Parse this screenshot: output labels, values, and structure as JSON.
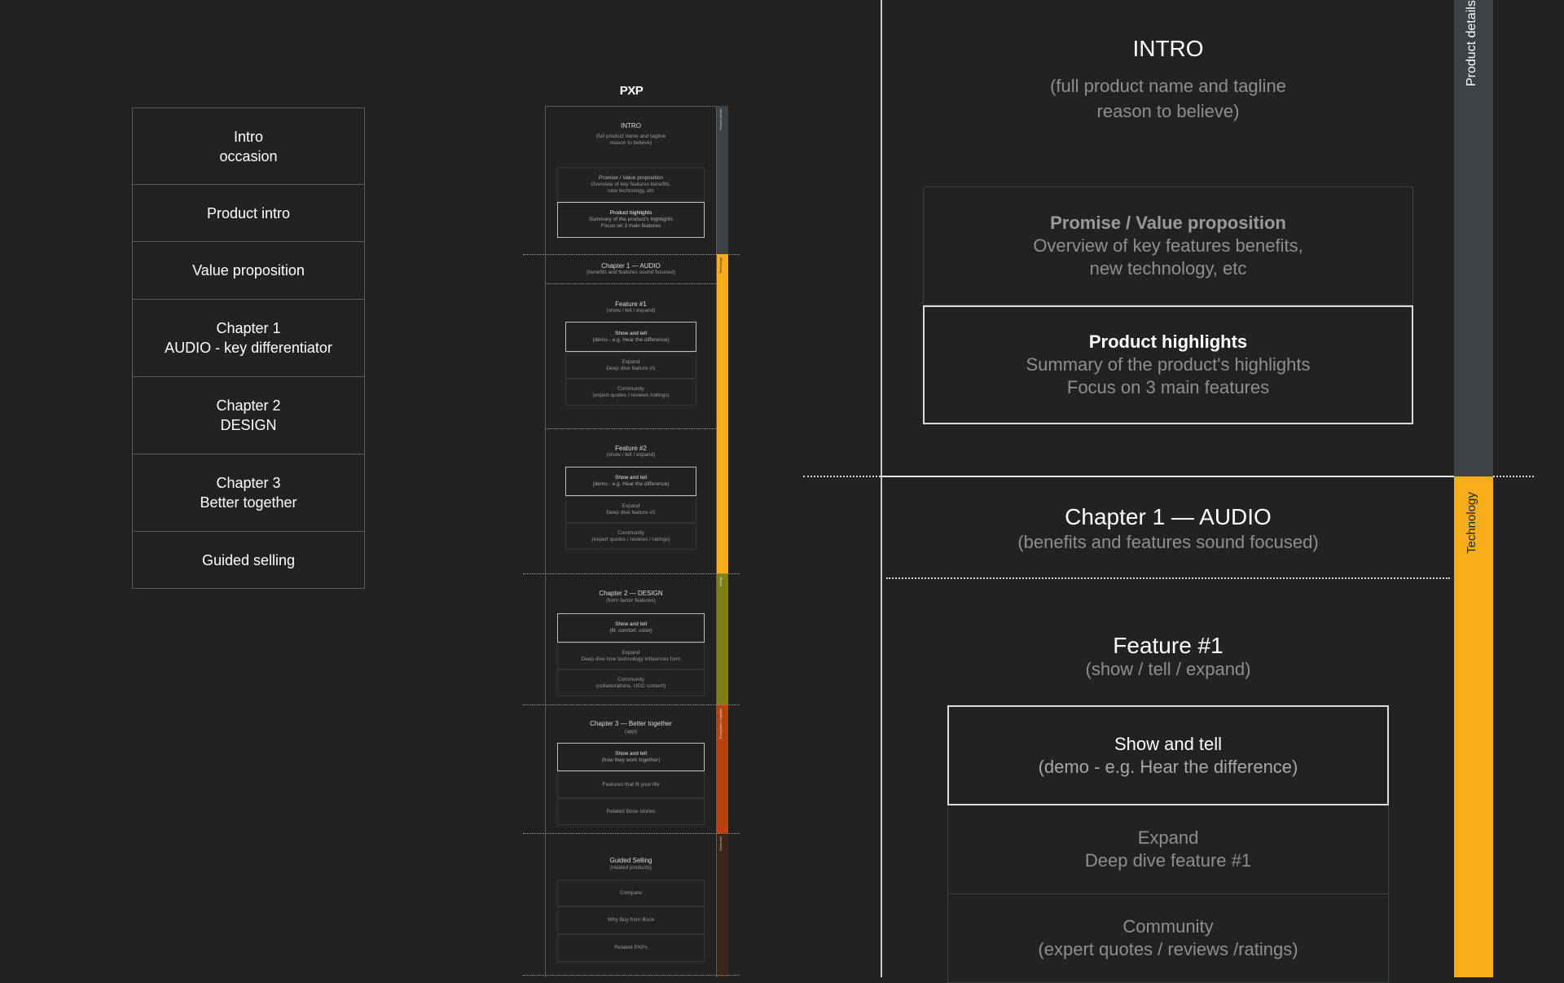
{
  "outline": [
    {
      "line1": "Intro",
      "line2": "occasion"
    },
    {
      "line1": "Product intro",
      "line2": ""
    },
    {
      "line1": "Value proposition",
      "line2": ""
    },
    {
      "line1": "Chapter 1",
      "line2": "AUDIO - key differentiator"
    },
    {
      "line1": "Chapter 2",
      "line2": "DESIGN"
    },
    {
      "line1": "Chapter 3",
      "line2": "Better together"
    },
    {
      "line1": "Guided selling",
      "line2": ""
    }
  ],
  "mini": {
    "logo": "PXP",
    "intro": {
      "title": "INTRO",
      "sub1": "(full product name and tagline",
      "sub2": "reason to believe)",
      "promise": [
        "Promise / Value proposition",
        "Overview of key features benefits,",
        "new technology, etc"
      ],
      "highlights": [
        "Product highlights",
        "Summary of the product's highlights",
        "Focus on 3 main features"
      ],
      "side": "Product details"
    },
    "ch1": {
      "title": "Chapter 1 — AUDIO",
      "sub": "(benefits and features sound focused)",
      "side": "Technology"
    },
    "f1": {
      "title": "Feature #1",
      "sub": "(show / tell / expand)",
      "show": [
        "Show and tell",
        "(demo - e.g. Hear the difference)"
      ],
      "expand": [
        "Expand",
        "Deep dive feature #1"
      ],
      "community": [
        "Community",
        "(expert quotes / reviews /ratings)"
      ]
    },
    "f2": {
      "title": "Feature #2",
      "sub": "(show / tell / expand)",
      "show": [
        "Show and tell",
        "(demo - e.g. Hear the difference)"
      ],
      "expand": [
        "Expand",
        "Deep dive feature #2"
      ],
      "community": [
        "Community",
        "(expert quotes / reviews / ratings)"
      ]
    },
    "ch2": {
      "title": "Chapter 2 — DESIGN",
      "sub": "(form factor features)",
      "show": [
        "Show and tell",
        "(fit, comfort, color)"
      ],
      "expand": [
        "Expand",
        "Deep dive how technology influences form"
      ],
      "community": [
        "Community",
        "(collaborations, UGC content)"
      ],
      "side": "Design"
    },
    "ch3": {
      "title": "Chapter 3 — Better together",
      "sub": "(app)",
      "show": [
        "Show and tell",
        "(how they work together)"
      ],
      "fit": "Features that fit your life",
      "stories": "Related Bose stories",
      "side": "Ecosystem / together"
    },
    "gs": {
      "title": "Guided Selling",
      "sub": "(related products)",
      "compare": "Compare",
      "why": "Why Buy from Bose",
      "related": "Related PXPs",
      "side": "Cross sell"
    }
  },
  "detail": {
    "intro_title": "INTRO",
    "intro_sub1": "(full product name and tagline",
    "intro_sub2": "reason to believe)",
    "promise": [
      "Promise / Value proposition",
      "Overview of key features benefits,",
      "new technology, etc"
    ],
    "highlights": [
      "Product highlights",
      "Summary of the product's highlights",
      "Focus on 3 main features"
    ],
    "side_product": "Product details",
    "side_tech": "Technology",
    "ch1_title": "Chapter 1  — AUDIO",
    "ch1_sub": "(benefits and features sound focused)",
    "f1_title": "Feature #1",
    "f1_sub": "(show / tell / expand)",
    "show": [
      "Show and tell",
      "(demo - e.g. Hear the difference)"
    ],
    "expand": [
      "Expand",
      "Deep dive feature #1"
    ],
    "community": [
      "Community",
      "(expert quotes / reviews /ratings)"
    ]
  },
  "colors": {
    "background": "#222222",
    "product_details_band": "#3c4245",
    "technology_band": "#f9ad1b",
    "design_band": "#7f7d16",
    "together_band": "#b8420e",
    "cross_sell_band": "#3a2618"
  }
}
